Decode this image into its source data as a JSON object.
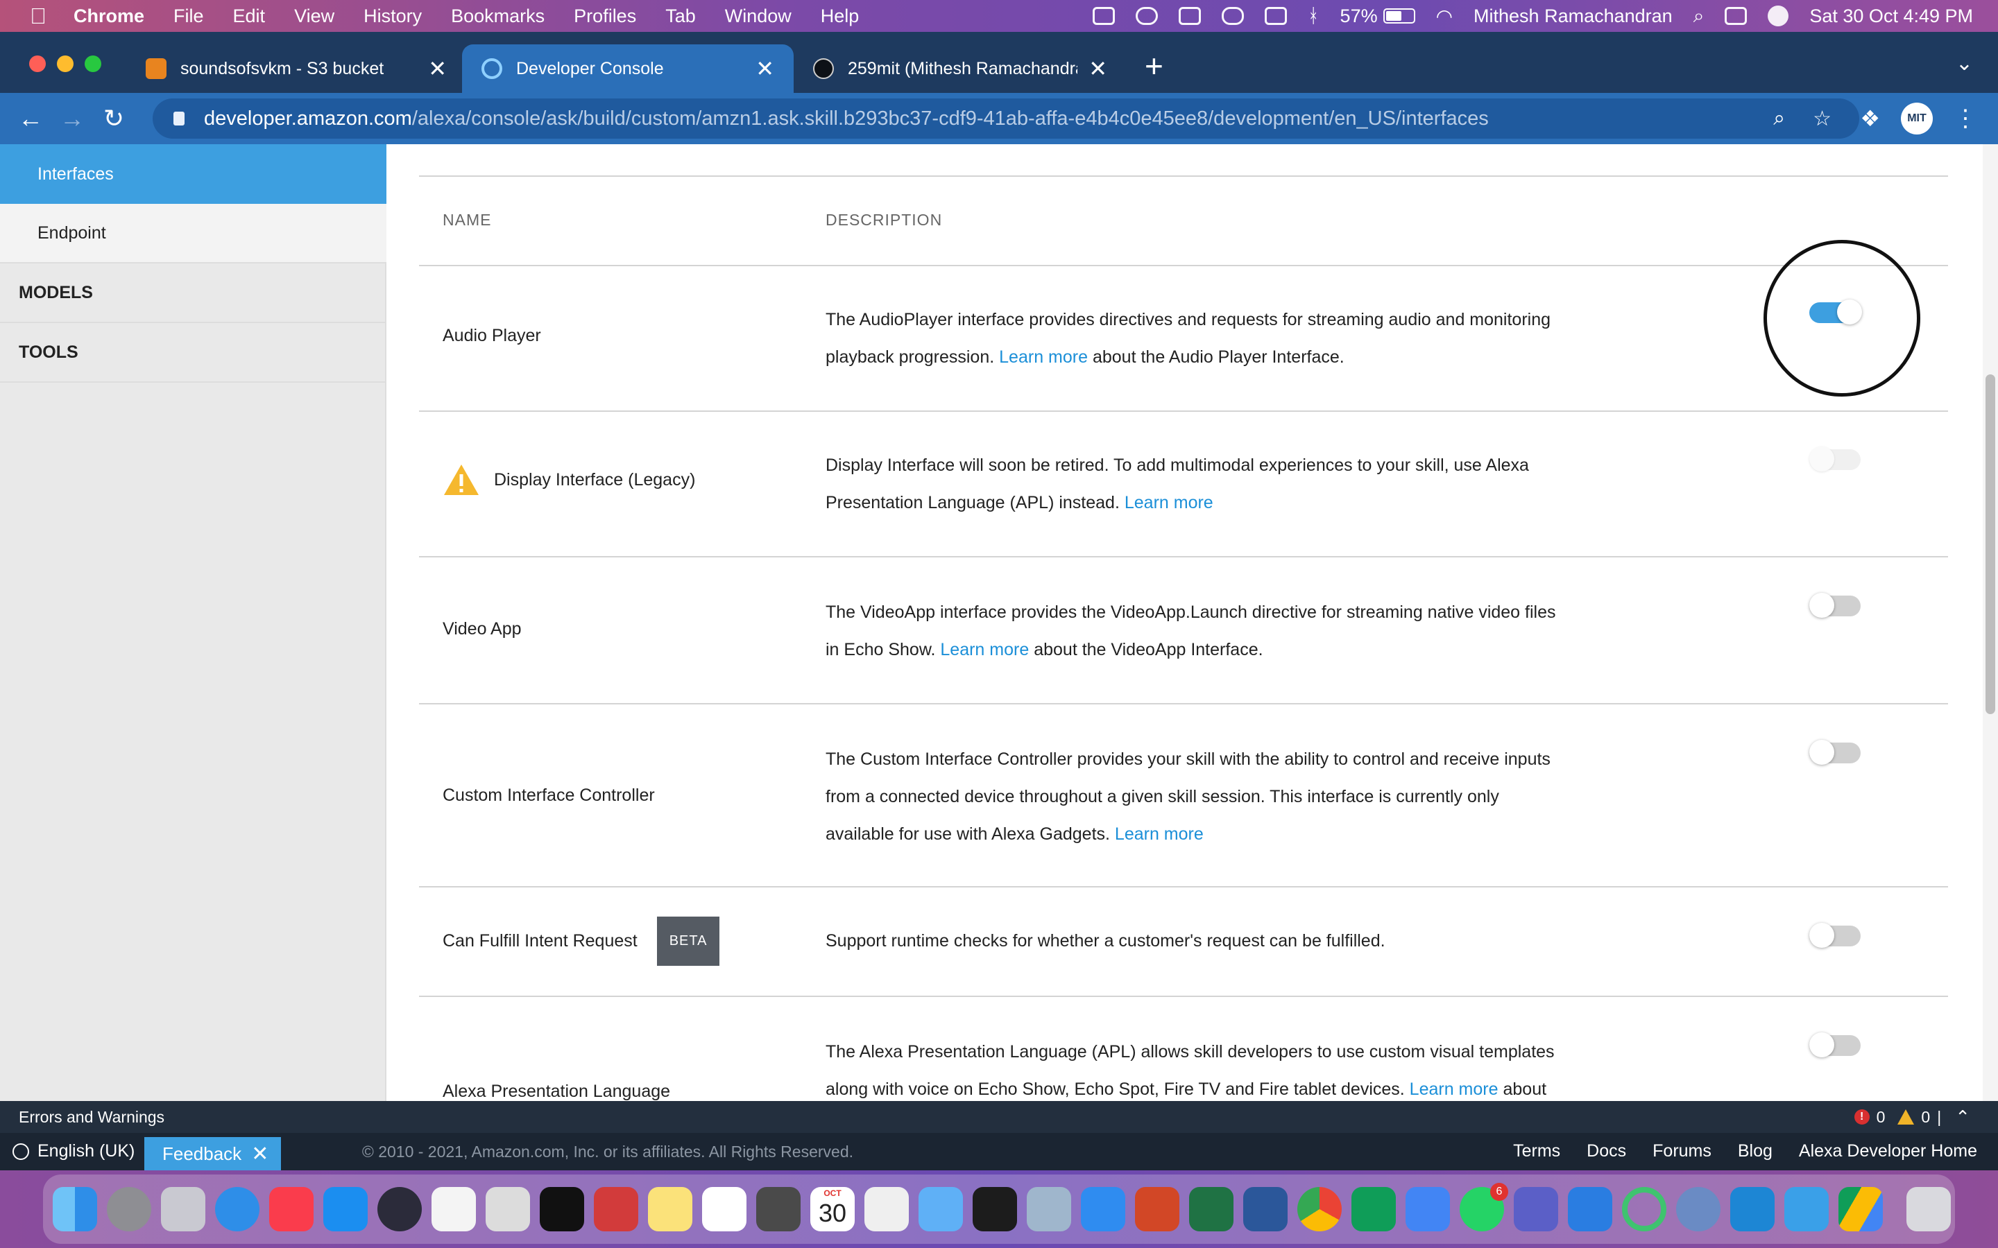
{
  "menubar": {
    "app_name": "Chrome",
    "items": [
      "File",
      "Edit",
      "View",
      "History",
      "Bookmarks",
      "Profiles",
      "Tab",
      "Window",
      "Help"
    ],
    "battery": "57%",
    "battery_level": 0.57,
    "user": "Mithesh Ramachandran",
    "datetime": "Sat 30 Oct  4:49 PM"
  },
  "tabs": [
    {
      "title": "soundsofsvkm - S3 bucket",
      "active": false
    },
    {
      "title": "Developer Console",
      "active": true
    },
    {
      "title": "259mit (Mithesh Ramachandran",
      "active": false
    }
  ],
  "address": {
    "host": "developer.amazon.com",
    "path": "/alexa/console/ask/build/custom/amzn1.ask.skill.b293bc37-cdf9-41ab-affa-e4b4c0e45ee8/development/en_US/interfaces"
  },
  "profile_initials": "MIT",
  "sidebar": {
    "active": "Interfaces",
    "sub": "Endpoint",
    "sections": [
      "MODELS",
      "TOOLS"
    ]
  },
  "table": {
    "col_name": "NAME",
    "col_description": "DESCRIPTION",
    "rows": [
      {
        "name": "Audio Player",
        "desc_pre": "The AudioPlayer interface provides directives and requests for streaming audio and monitoring playback progression.",
        "link": "Learn more",
        "desc_post": "about the Audio Player Interface.",
        "state": "on"
      },
      {
        "name": "Display Interface (Legacy)",
        "desc_pre": "Display Interface will soon be retired. To add multimodal experiences to your skill, use Alexa Presentation Language (APL) instead.",
        "link": "Learn more",
        "desc_post": "",
        "state": "disabled"
      },
      {
        "name": "Video App",
        "desc_pre": "The VideoApp interface provides the VideoApp.Launch directive for streaming native video files in Echo Show.",
        "link": "Learn more",
        "desc_post": "about the VideoApp Interface.",
        "state": "off"
      },
      {
        "name": "Custom Interface Controller",
        "desc_pre": "The Custom Interface Controller provides your skill with the ability to control and receive inputs from a connected device throughout a given skill session. This interface is currently only available for use with Alexa Gadgets.",
        "link": "Learn more",
        "desc_post": "",
        "state": "off"
      },
      {
        "name": "Can Fulfill Intent Request",
        "badge": "BETA",
        "desc_pre": "Support runtime checks for whether a customer's request can be fulfilled.",
        "link": "",
        "desc_post": "",
        "state": "off"
      },
      {
        "name": "Alexa Presentation Language",
        "desc_pre": "The Alexa Presentation Language (APL) allows skill developers to use custom visual templates along with voice on Echo Show, Echo Spot, Fire TV and Fire tablet devices.",
        "link": "Learn more",
        "desc_post": "about",
        "state": "off"
      }
    ]
  },
  "errors": {
    "label": "Errors and Warnings",
    "error_count": "0",
    "warning_count": "0"
  },
  "footer": {
    "language": "English (UK)",
    "feedback": "Feedback",
    "copyright": "© 2010 - 2021, Amazon.com, Inc. or its affiliates. All Rights Reserved.",
    "links": [
      "Terms",
      "Docs",
      "Forums",
      "Blog",
      "Alexa Developer Home"
    ]
  },
  "dock": {
    "calendar_month": "OCT",
    "calendar_day": "30",
    "whatsapp_badge": "6"
  },
  "colors": {
    "accent": "#3d9fe0",
    "link": "#1b8fd8",
    "tabbar": "#1e3a5f",
    "toolbar": "#2b6fb8"
  }
}
